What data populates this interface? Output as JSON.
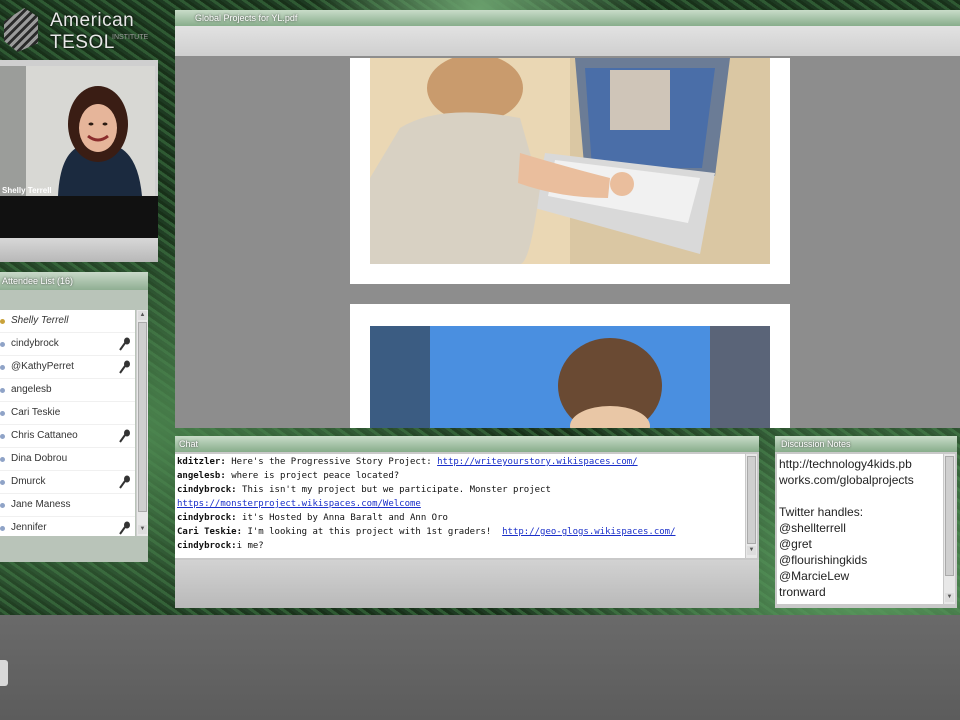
{
  "logo": {
    "name": "American TESOL",
    "sub": "INSTITUTE"
  },
  "webcam": {
    "presenter_name": "Shelly Terrell"
  },
  "attendees": {
    "title": "Attendee List (16)",
    "items": [
      {
        "name": "Shelly Terrell",
        "moderator": true,
        "mic": false
      },
      {
        "name": "cindybrock",
        "moderator": false,
        "mic": true
      },
      {
        "name": "@KathyPerret",
        "moderator": false,
        "mic": true
      },
      {
        "name": "angelesb",
        "moderator": false,
        "mic": false
      },
      {
        "name": "Cari Teskie",
        "moderator": false,
        "mic": false
      },
      {
        "name": "Chris Cattaneo",
        "moderator": false,
        "mic": true
      },
      {
        "name": "Dina Dobrou",
        "moderator": false,
        "mic": false
      },
      {
        "name": "Dmurck",
        "moderator": false,
        "mic": true
      },
      {
        "name": "Jane Maness",
        "moderator": false,
        "mic": false
      },
      {
        "name": "Jennifer",
        "moderator": false,
        "mic": true
      }
    ]
  },
  "document": {
    "title": "Global Projects for YL.pdf"
  },
  "chat": {
    "title": "Chat",
    "messages": [
      {
        "sender": "kditzler:",
        "text": " Here's the Progressive Story Project: ",
        "link": "http://writeyourstory.wikispaces.com/"
      },
      {
        "sender": "angelesb:",
        "text": " where is project peace located?",
        "link": ""
      },
      {
        "sender": "cindybrock:",
        "text": " This isn't my project but we participate. Monster project",
        "link": ""
      },
      {
        "sender": "",
        "text": "",
        "link": "https://monsterproject.wikispaces.com/Welcome"
      },
      {
        "sender": "cindybrock:",
        "text": " it's Hosted by Anna Baralt and Ann Oro",
        "link": ""
      },
      {
        "sender": "Cari Teskie:",
        "text": " I'm looking at this project with 1st graders!  ",
        "link": "http://geo-glogs.wikispaces.com/"
      },
      {
        "sender": "cindybrock:",
        "text": "i me?",
        "link": ""
      }
    ]
  },
  "notes": {
    "title": "Discussion Notes",
    "lines": [
      "http://technology4kids.pb",
      "works.com/globalprojects",
      "",
      "Twitter handles:",
      "@shellterrell",
      "@gret",
      "@flourishingkids",
      "@MarcieLew",
      "tronward"
    ]
  }
}
